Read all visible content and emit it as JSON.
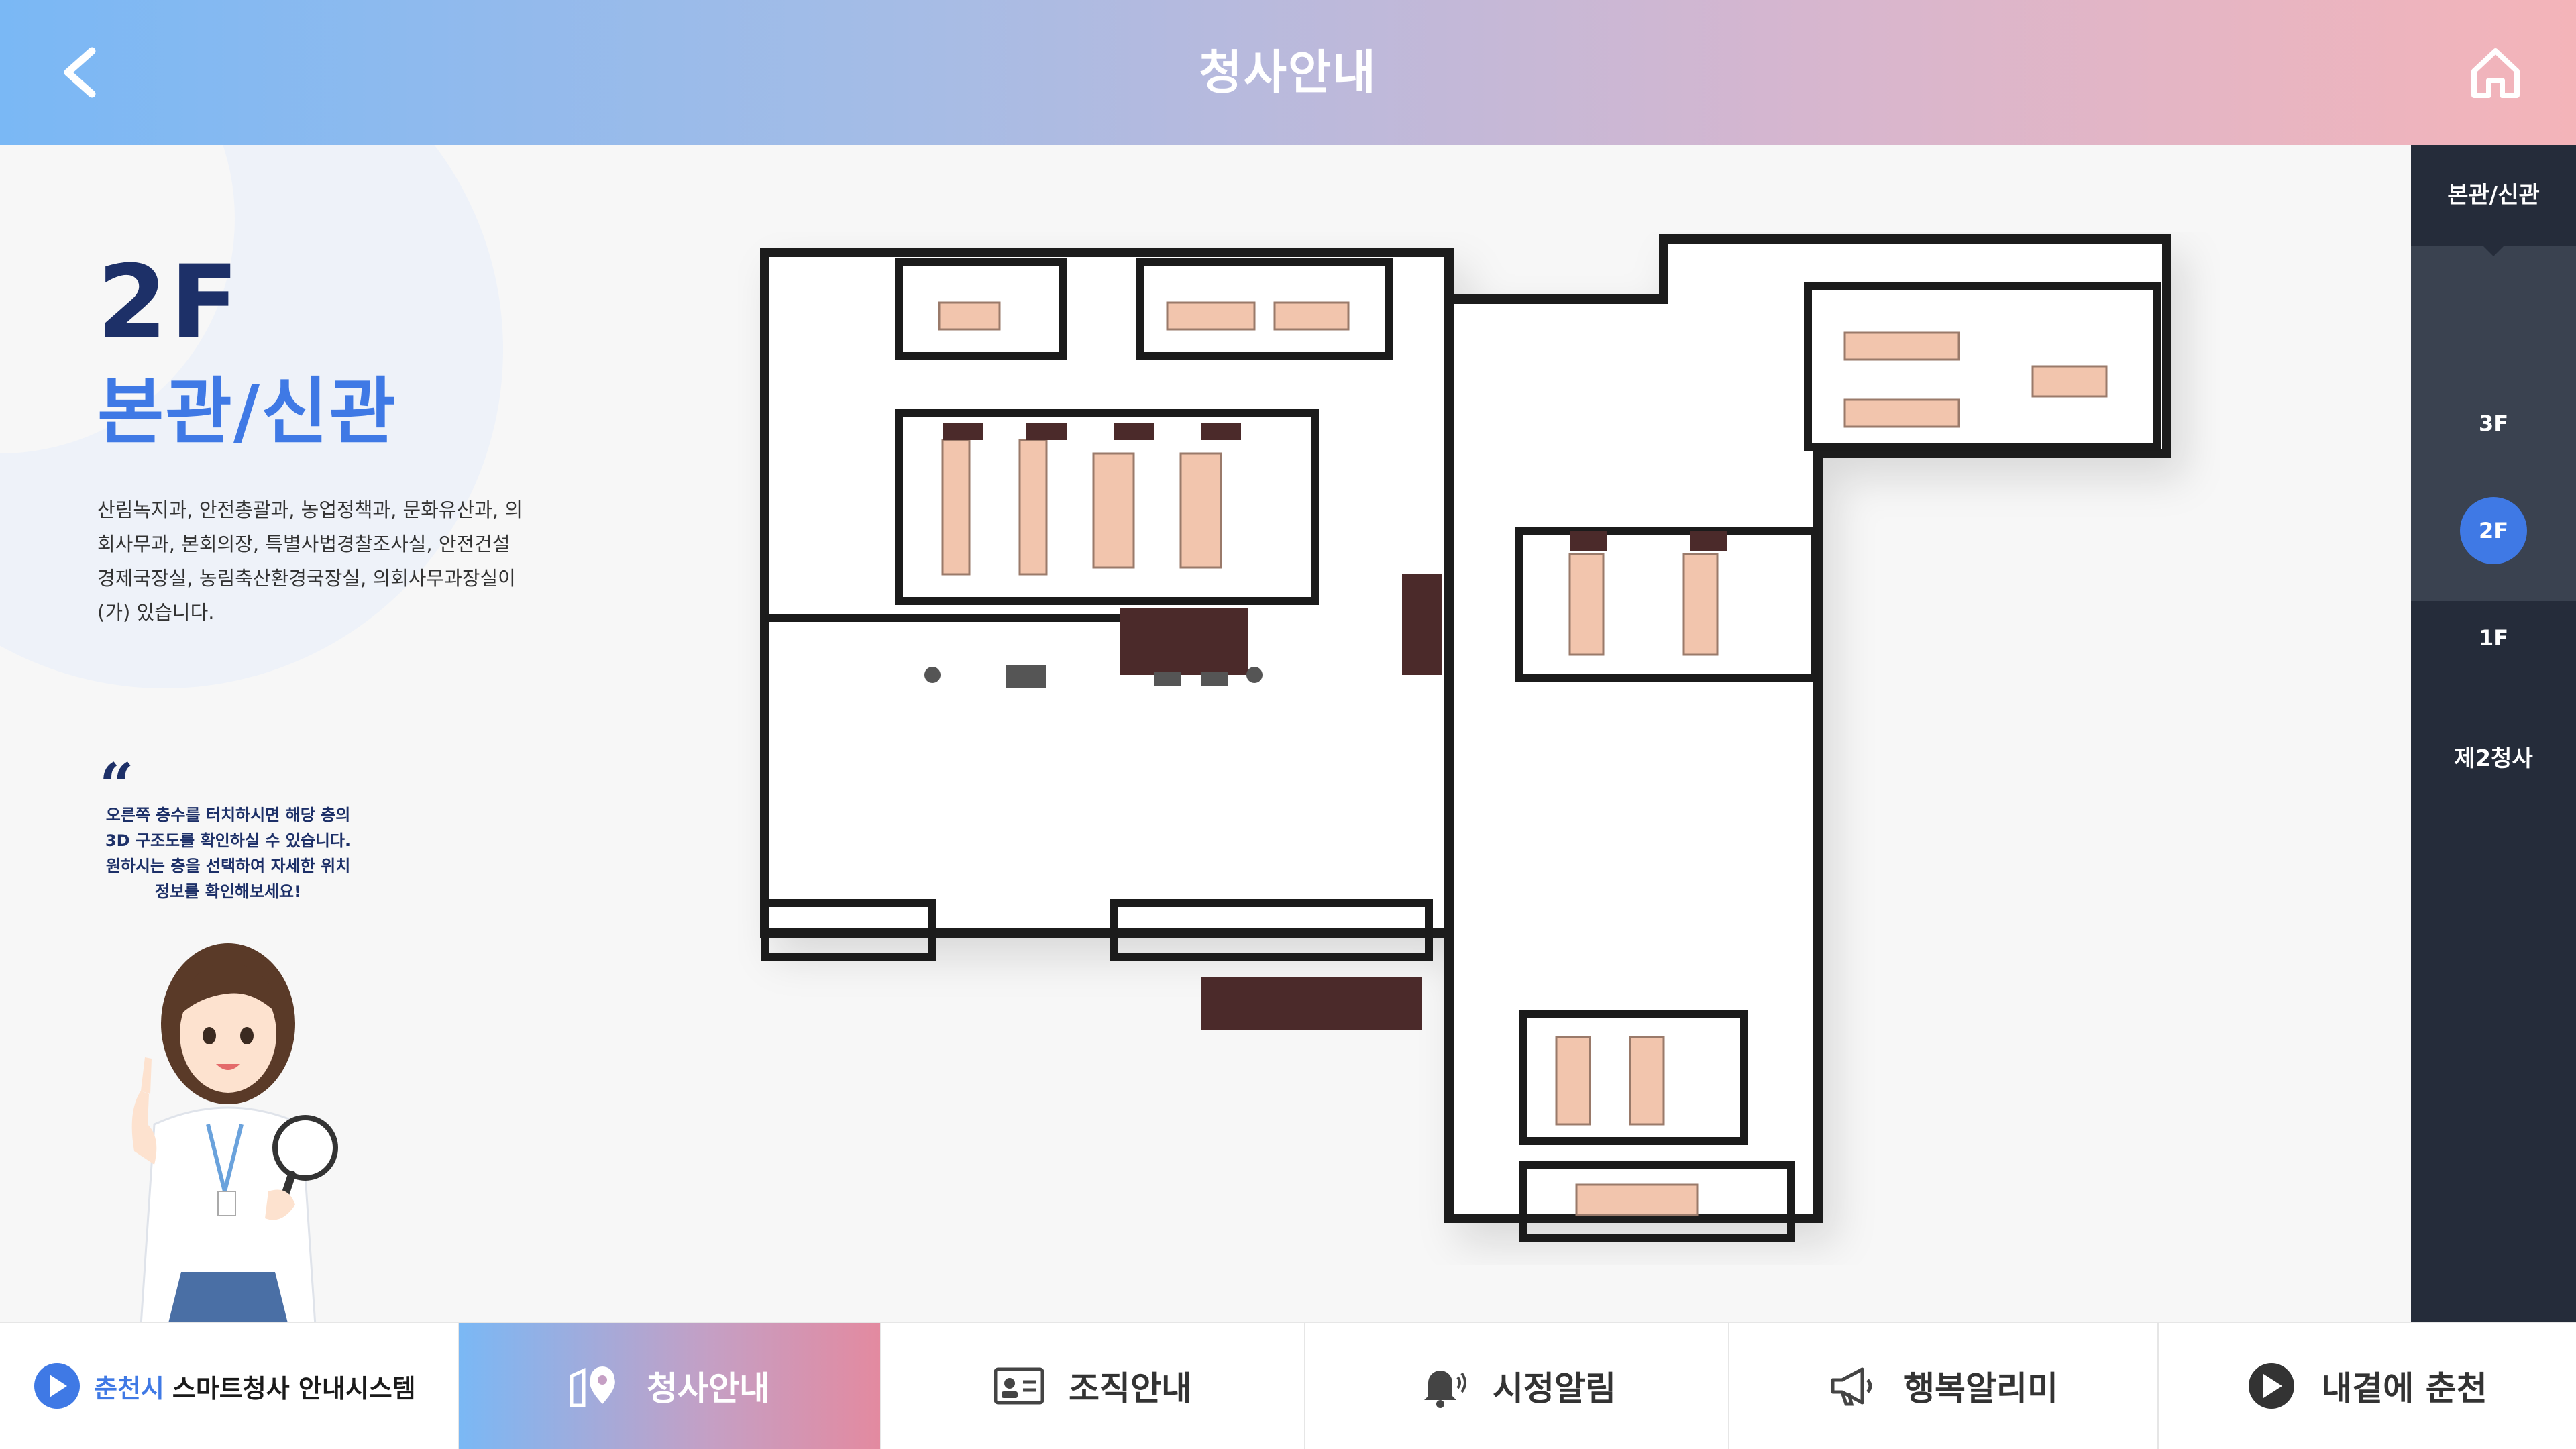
{
  "header": {
    "title": "청사안내",
    "back_icon": "chevron-left-icon",
    "home_icon": "home-icon"
  },
  "info": {
    "floor": "2F",
    "building": "본관/신관",
    "description": "산림녹지과, 안전총괄과, 농업정책과, 문화유산과, 의회사무과, 본회의장, 특별사법경찰조사실, 안전건설경제국장실, 농림축산환경국장실, 의회사무과장실이(가) 있습니다.",
    "hint_lines": [
      "오른쪽 층수를 터치하시면 해당 층의",
      "3D 구조도를 확인하실 수 있습니다.",
      "원하시는 층을 선택하여 자세한 위치",
      "정보를 확인해보세요!"
    ]
  },
  "sidebar": {
    "building_main": "본관/신관",
    "floors": [
      {
        "label": "3F",
        "active": false
      },
      {
        "label": "2F",
        "active": true
      },
      {
        "label": "1F",
        "active": false
      }
    ],
    "building_second": "제2청사"
  },
  "bottom_nav": {
    "logo_city": "춘천시",
    "logo_title": "스마트청사 안내시스템",
    "items": [
      {
        "label": "청사안내",
        "icon": "map-pin-icon",
        "active": true
      },
      {
        "label": "조직안내",
        "icon": "id-card-icon",
        "active": false
      },
      {
        "label": "시정알림",
        "icon": "bell-icon",
        "active": false
      },
      {
        "label": "행복알리미",
        "icon": "megaphone-icon",
        "active": false
      },
      {
        "label": "내곁에 춘천",
        "icon": "chuncheon-logo-icon",
        "active": false
      }
    ]
  },
  "colors": {
    "accent": "#3f79e5",
    "navy": "#1d3068",
    "sidebar": "#252c3a"
  }
}
